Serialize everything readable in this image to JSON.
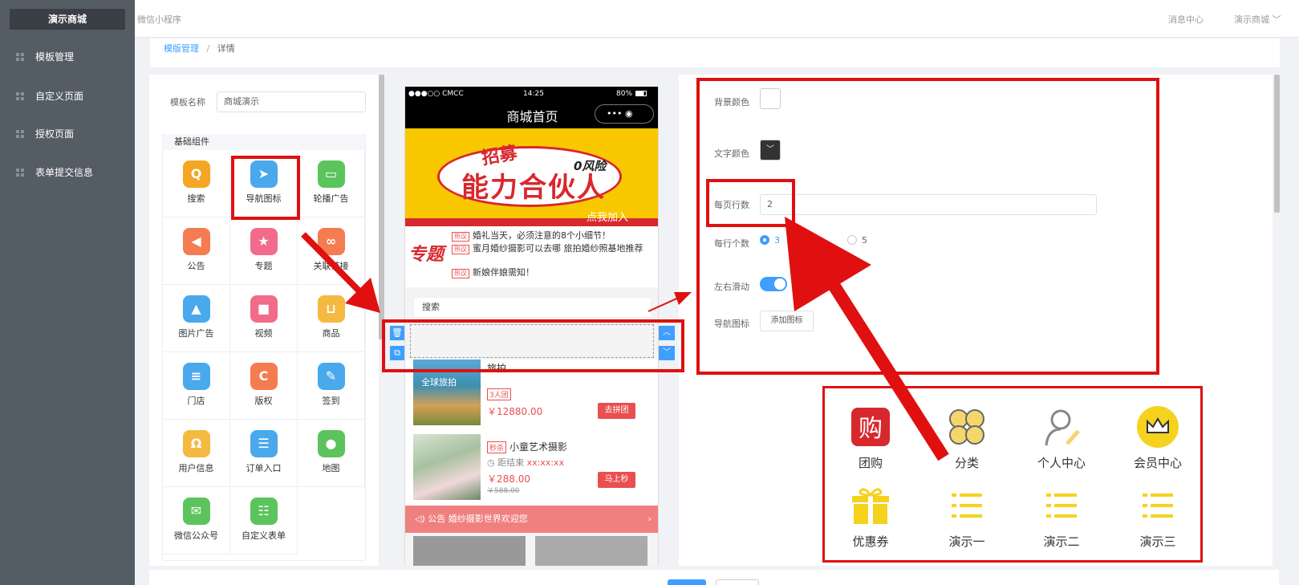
{
  "sidebar": {
    "logo": "演示商城",
    "items": [
      "模板管理",
      "自定义页面",
      "授权页面",
      "表单提交信息"
    ]
  },
  "topbar": {
    "app": "微信小程序",
    "message_center": "消息中心",
    "store": "演示商城"
  },
  "breadcrumb": {
    "parent": "模版管理",
    "current": "详情"
  },
  "left": {
    "name_label": "模板名称",
    "name_value": "商城演示",
    "group_title": "基础组件",
    "components": [
      {
        "label": "搜索",
        "color": "#f5a623",
        "glyph": "Q"
      },
      {
        "label": "导航图标",
        "color": "#4aa8ec",
        "glyph": "➤"
      },
      {
        "label": "轮播广告",
        "color": "#5cc45c",
        "glyph": "▭"
      },
      {
        "label": "公告",
        "color": "#f57b51",
        "glyph": "◀"
      },
      {
        "label": "专题",
        "color": "#f26b8a",
        "glyph": "★"
      },
      {
        "label": "关联链接",
        "color": "#f57b51",
        "glyph": "∞"
      },
      {
        "label": "图片广告",
        "color": "#4aa8ec",
        "glyph": "▲"
      },
      {
        "label": "视频",
        "color": "#f26b8a",
        "glyph": "■"
      },
      {
        "label": "商品",
        "color": "#f5b942",
        "glyph": "⊔"
      },
      {
        "label": "门店",
        "color": "#4aa8ec",
        "glyph": "≡"
      },
      {
        "label": "版权",
        "color": "#f57b51",
        "glyph": "C"
      },
      {
        "label": "签到",
        "color": "#4aa8ec",
        "glyph": "✎"
      },
      {
        "label": "用户信息",
        "color": "#f5b942",
        "glyph": "Ω"
      },
      {
        "label": "订单入口",
        "color": "#4aa8ec",
        "glyph": "☰"
      },
      {
        "label": "地图",
        "color": "#5cc45c",
        "glyph": "●"
      },
      {
        "label": "微信公众号",
        "color": "#5cc45c",
        "glyph": "✉"
      },
      {
        "label": "自定义表单",
        "color": "#5cc45c",
        "glyph": "☷"
      }
    ]
  },
  "phone": {
    "carrier": "●●●○○ CMCC",
    "time": "14:25",
    "battery": "80%",
    "title": "商城首页",
    "capsule": "•••  ◉",
    "banner": {
      "recruit": "招募",
      "headline": "能力合伙人",
      "zero_risk": "0风险",
      "join": "点我加入"
    },
    "topic": {
      "title": "专题",
      "tag": "热议",
      "items": [
        "婚礼当天，必须注意的8个小细节！",
        "蜜月婚纱摄影可以去哪 旅拍婚纱照基地推荐",
        "新娘伴娘需知！"
      ]
    },
    "search": "搜索",
    "products": [
      {
        "title": "旅拍",
        "overlay": "全球旅拍",
        "badge": "3人团",
        "price": "￥12880.00",
        "button": "去拼团"
      },
      {
        "title": "小童艺术摄影",
        "badge": "秒杀",
        "countdown_label": "距结束",
        "countdown": "xx:xx:xx",
        "price": "￥288.00",
        "old_price": "￥588.00",
        "button": "马上秒"
      }
    ],
    "notice_label": "公告",
    "notice_text": "婚纱摄影世界欢迎您"
  },
  "right": {
    "bg_color_label": "背景颜色",
    "text_color_label": "文字颜色",
    "rows_label": "每页行数",
    "rows_value": "2",
    "cols_label": "每行个数",
    "cols_options": [
      "3",
      "5"
    ],
    "cols_selected": "3",
    "swipe_label": "左右滑动",
    "swipe_on": true,
    "nav_icon_label": "导航图标",
    "add_icon": "添加图标"
  },
  "preview_icons": [
    "团购",
    "分类",
    "个人中心",
    "会员中心",
    "优惠券",
    "演示一",
    "演示二",
    "演示三"
  ],
  "colors": {
    "accent": "#409eff",
    "annotation_red": "#e01010",
    "sidebar": "#545c64"
  }
}
